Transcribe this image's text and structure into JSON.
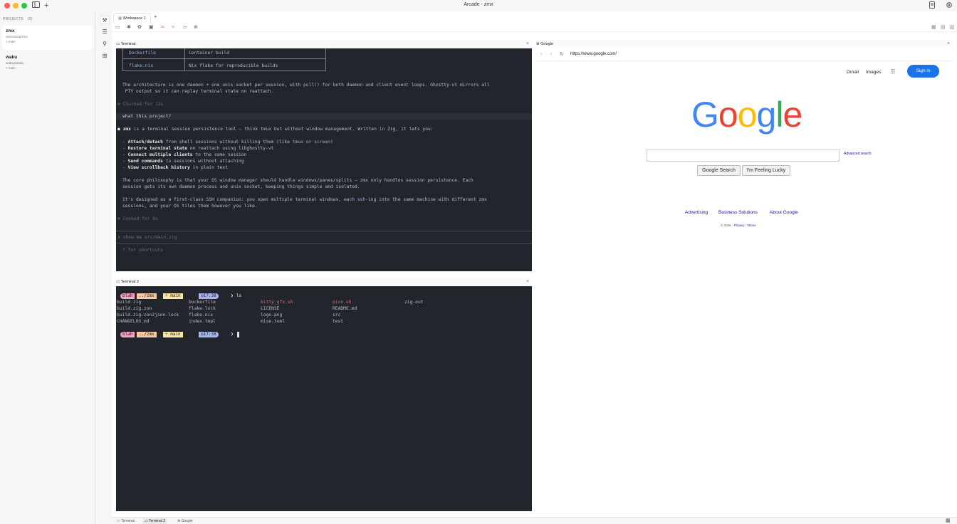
{
  "window": {
    "title": "Arcade - zmx"
  },
  "sidebar": {
    "header": "PROJECTS",
    "count": "(2)",
    "projects": [
      {
        "name": "zmx",
        "path": "neurosnap/zmx",
        "branch": "main"
      },
      {
        "name": "waku",
        "path": "wakujs/waku",
        "branch": "main"
      }
    ]
  },
  "tabs": {
    "workspace": "Workspace 1",
    "add": "+"
  },
  "terminal1": {
    "title": "Terminal",
    "table": [
      {
        "file": "Dockerfile",
        "desc": "Container build"
      },
      {
        "file": "flake.nix",
        "desc": "Nix flake for reproducible builds"
      }
    ],
    "arch_1a": "The architecture is one daemon + one unix socket per session, with ",
    "arch_1b": "poll()",
    "arch_1c": " for both daemon and client event loops. Ghostty-vt mirrors all",
    "arch_2": " PTY output so it can replay terminal state on reattach.",
    "churned": "✻ Churned for 13s",
    "question": "what this project?",
    "answer_bullet": "●",
    "answer_name": "zmx",
    "answer_rest": " is a terminal session persistence tool — think tmux but without window management. Written in Zig, it lets you:",
    "b1_bold": "Attach/detach",
    "b1_mid": " from shell sessions without killing them (like ",
    "b1_tmux": "tmux",
    "b1_or": " or ",
    "b1_screen": "screen",
    "b1_end": ")",
    "b2_bold": "Restore terminal state",
    "b2_rest": " on reattach using libghostty-vt",
    "b3_bold": "Connect multiple clients",
    "b3_rest": " to the same session",
    "b4_bold": "Send commands",
    "b4_rest": " to sessions without attaching",
    "b5_bold": "View scrollback history",
    "b5_rest": " in plain text",
    "core_1": "The core philosophy is that your OS window manager should handle windows/panes/splits — zmx only handles session persistence. Each",
    "core_2": "session gets its own daemon process and unix socket, keeping things simple and isolated.",
    "ssh_1a": "It's designed as a first-class SSH companion: you open multiple terminal windows, each ",
    "ssh_1b": "ssh",
    "ssh_1c": "-ing into the same machine with different zmx",
    "ssh_2": "sessions, and your OS tiles them however you like.",
    "cooked": "✻ Cooked for 8s",
    "input": "❯ show me src/main.zig",
    "shortcuts": "? for shortcuts"
  },
  "terminal2": {
    "title": "Terminal 2",
    "prompt_user": "blah",
    "prompt_dir": "../zmx",
    "prompt_branch": "main",
    "prompt_time": "17:38",
    "cmd": "❯ ls",
    "prompt_end": "❯",
    "files": [
      [
        "build.zig",
        "Dockerfile",
        "kitty_gfx.sh",
        "pico.sh",
        "zig-out"
      ],
      [
        "build.zig.zon",
        "flake.lock",
        "LICENSE",
        "README.md",
        ""
      ],
      [
        "build.zig.zon2json-lock",
        "flake.nix",
        "logo.png",
        "src",
        ""
      ],
      [
        "CHANGELOG.md",
        "index.tmpl",
        "mise.toml",
        "test",
        ""
      ]
    ]
  },
  "browser": {
    "title": "Google",
    "url": "https://www.google.com/",
    "gmail": "Gmail",
    "images": "Images",
    "signin": "Sign in",
    "logo": [
      "G",
      "o",
      "o",
      "g",
      "l",
      "e"
    ],
    "logo_colors": [
      "#4285f4",
      "#ea4335",
      "#fbbc05",
      "#4285f4",
      "#34a853",
      "#ea4335"
    ],
    "advanced": "Advanced search",
    "search_btn": "Google Search",
    "lucky_btn": "I'm Feeling Lucky",
    "footer": [
      "Advertising",
      "Business Solutions",
      "About Google"
    ],
    "copyright": "© 2026 -",
    "privacy": "Privacy",
    "dash": "-",
    "terms": "Terms"
  },
  "statusbar": {
    "tabs": [
      "Terminal",
      "Terminal 2",
      "Google"
    ]
  },
  "colors": {
    "prompt_user_bg": "#f4a6c0",
    "prompt_dir_bg": "#f6c7a2",
    "prompt_branch_bg": "#f9e4a6",
    "prompt_time_bg": "#a6b4f0",
    "signin_bg": "#1a73e8",
    "terminal_bg": "#22252b"
  }
}
